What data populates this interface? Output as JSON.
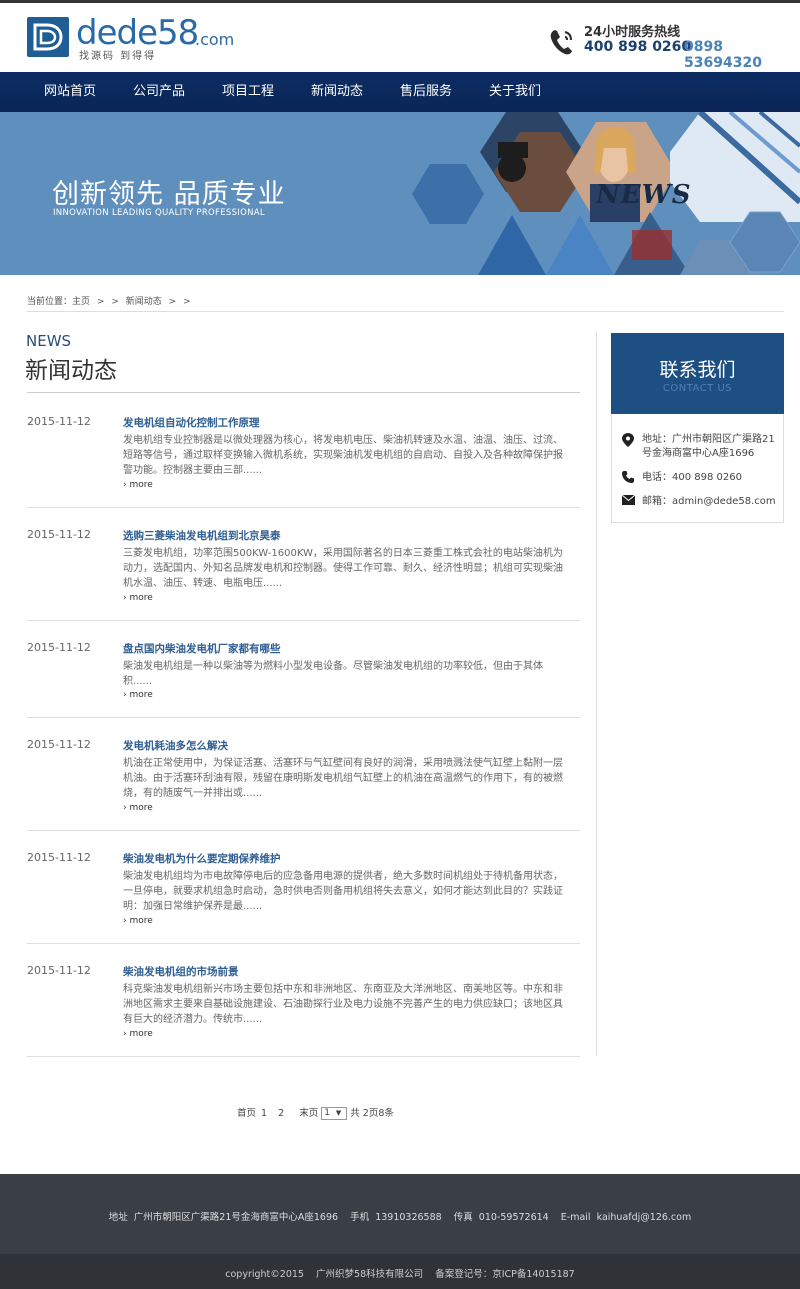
{
  "header": {
    "logo_text": "dede58",
    "logo_domain": ".com",
    "logo_slogan": "找源码 到得得",
    "hotline_title": "24小时服务热线",
    "hotline_number_1": "400 898 0260",
    "hotline_number_2": "0898 53694320"
  },
  "nav": {
    "items": [
      "网站首页",
      "公司产品",
      "项目工程",
      "新闻动态",
      "售后服务",
      "关于我们"
    ]
  },
  "banner": {
    "title": "创新领先 品质专业",
    "subtitle": "INNOVATION LEADING QUALITY PROFESSIONAL",
    "badge": "NEWS"
  },
  "breadcrumb": {
    "prefix": "当前位置：",
    "home": "主页",
    "sep1": ">",
    "sep2": ">",
    "current": "新闻动态",
    "sep3": ">",
    "sep4": ">"
  },
  "main": {
    "heading_en": "NEWS",
    "heading_cn": "新闻动态",
    "more_label": "more",
    "news": [
      {
        "date": "2015-11-12",
        "title": "发电机组自动化控制工作原理",
        "desc": "发电机组专业控制器是以微处理器为核心，将发电机电压、柴油机转速及水温、油温、油压、过流、短路等信号，通过取样变换输入微机系统，实现柴油机发电机组的自启动、自投入及各种故障保护报警功能。控制器主要由三部......"
      },
      {
        "date": "2015-11-12",
        "title": "选购三菱柴油发电机组到北京昊泰",
        "desc": "三菱发电机组，功率范围500KW-1600KW，采用国际著名的日本三菱重工株式会社的电站柴油机为动力，选配国内、外知名品牌发电机和控制器。使得工作可靠、耐久、经济性明显；机组可实现柴油机水温、油压、转速、电瓶电压......"
      },
      {
        "date": "2015-11-12",
        "title": "盘点国内柴油发电机厂家都有哪些",
        "desc": "柴油发电机组是一种以柴油等为燃料小型发电设备。尽管柴油发电机组的功率较低，但由于其体积......"
      },
      {
        "date": "2015-11-12",
        "title": "发电机耗油多怎么解决",
        "desc": "机油在正常使用中，为保证活塞、活塞环与气缸壁间有良好的润滑，采用喷溅法使气缸壁上黏附一层机油。由于活塞环刮油有限，残留在康明斯发电机组气缸壁上的机油在高温燃气的作用下，有的被燃烧，有的随废气一并排出或......"
      },
      {
        "date": "2015-11-12",
        "title": "柴油发电机为什么要定期保养维护",
        "desc": "柴油发电机组均为市电故障停电后的应急备用电源的提供者，绝大多数时间机组处于待机备用状态，一旦停电，就要求机组急时启动，急时供电否则备用机组将失去意义，如何才能达到此目的？实践证明：加强日常维护保养是最......"
      },
      {
        "date": "2015-11-12",
        "title": "柴油发电机组的市场前景",
        "desc": "科克柴油发电机组新兴市场主要包括中东和非洲地区、东南亚及大洋洲地区、南美地区等。中东和非洲地区需求主要来自基础设施建设、石油勘探行业及电力设施不完善产生的电力供应缺口；该地区具有巨大的经济潜力。传统市......"
      }
    ]
  },
  "sidebar": {
    "contact_title_cn": "联系我们",
    "contact_title_en": "CONTACT US",
    "address": "地址：广州市朝阳区广渠路21号金海商富中心A座1696",
    "phone": "电话：400 898 0260",
    "email": "邮箱：admin@dede58.com"
  },
  "pager": {
    "first": "首页",
    "page1": "1",
    "page2": "2",
    "last": "末页",
    "selected": "1",
    "summary": "共 2页8条"
  },
  "footer": {
    "info": "地址  广州市朝阳区广渠路21号金海商富中心A座1696    手机  13910326588    传真  010-59572614    E-mail  kaihuafdj@126.com",
    "copyright": "copyright©2015    广州织梦58科技有限公司    备案登记号：京ICP备14015187"
  },
  "colors": {
    "nav_bg": "#0d2d63",
    "banner_bg": "#5f8fbd",
    "link_blue": "#2f5e92",
    "contact_head": "#1e4f82",
    "footer_bg": "#3a3f46"
  }
}
